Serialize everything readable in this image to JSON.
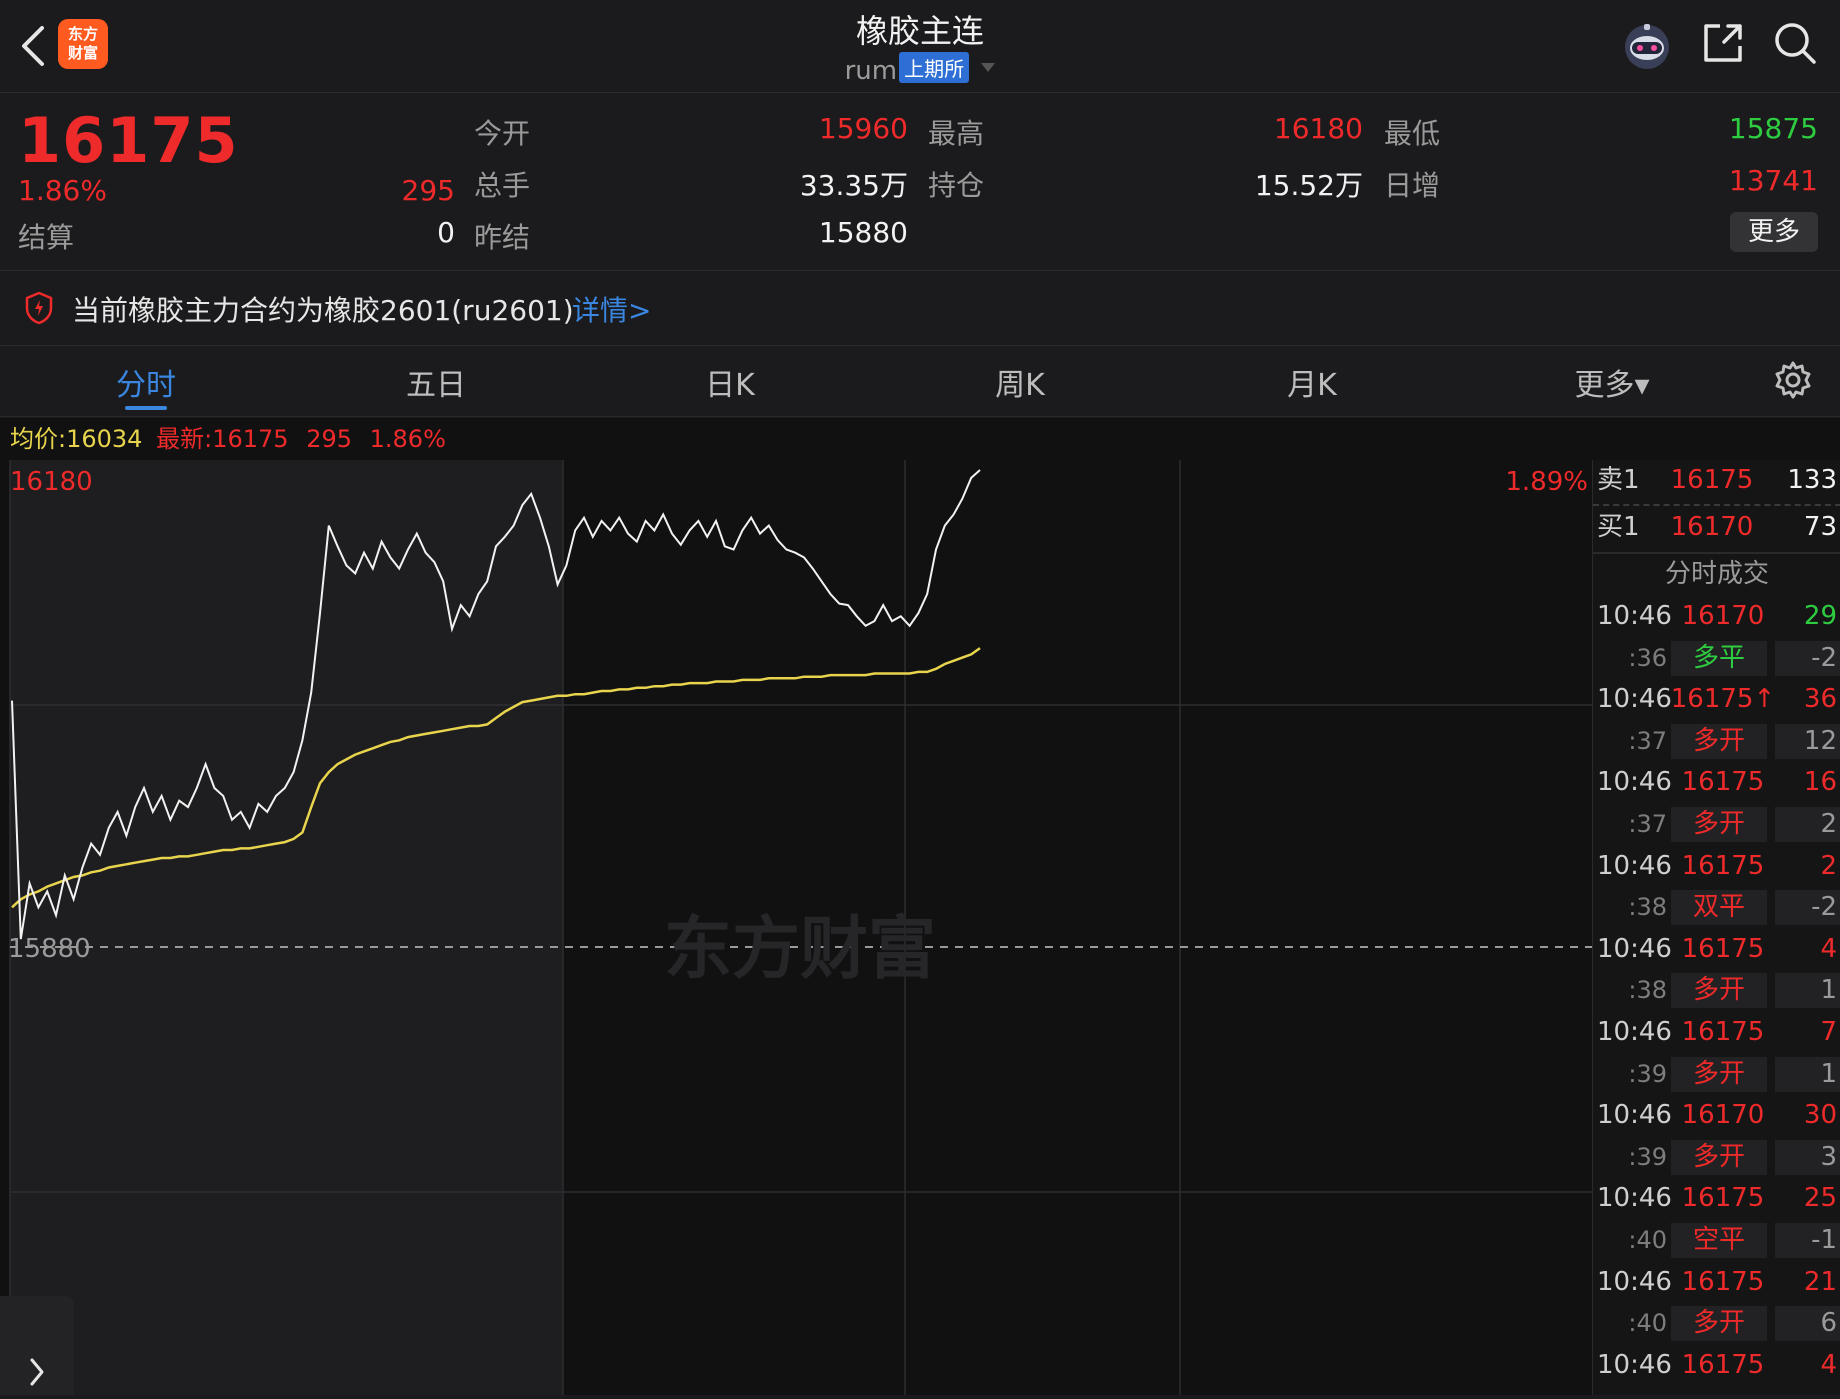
{
  "header": {
    "title": "橡胶主连",
    "code": "rum",
    "exchange": "上期所",
    "logo_line1": "东方",
    "logo_line2": "财富"
  },
  "quote": {
    "last_price": "16175",
    "change_pct": "1.86%",
    "change_value": "295",
    "settle_label": "结算",
    "settle_value": "0",
    "open_label": "今开",
    "open_value": "15960",
    "high_label": "最高",
    "high_value": "16180",
    "low_label": "最低",
    "low_value": "15875",
    "volume_label": "总手",
    "volume_value": "33.35万",
    "open_interest_label": "持仓",
    "open_interest_value": "15.52万",
    "daily_increase_label": "日增",
    "daily_increase_value": "13741",
    "prev_settle_label": "昨结",
    "prev_settle_value": "15880",
    "more_label": "更多"
  },
  "notice": {
    "text": "当前橡胶主力合约为橡胶2601(ru2601)",
    "link": "详情>"
  },
  "tabs": [
    {
      "label": "分时"
    },
    {
      "label": "五日"
    },
    {
      "label": "日K"
    },
    {
      "label": "周K"
    },
    {
      "label": "月K"
    },
    {
      "label": "更多▾"
    }
  ],
  "info_line": {
    "avg_label": "均价:",
    "avg_value": "16034",
    "latest_label": "最新:",
    "latest_price": "16175",
    "latest_change": "295",
    "latest_pct": "1.86%"
  },
  "chart_data": {
    "type": "line",
    "top_label": "16180",
    "top_pct_label": "1.89%",
    "ref_label": "15880",
    "watermark": "东方财富",
    "y_range": [
      15875,
      16180
    ],
    "ref_value": 15880,
    "series": [
      {
        "values": [
          16035,
          15885,
          15920,
          15905,
          15915,
          15900,
          15925,
          15910,
          15930,
          15945,
          15938,
          15955,
          15965,
          15950,
          15968,
          15980,
          15965,
          15975,
          15960,
          15972,
          15968,
          15980,
          15995,
          15980,
          15975,
          15960,
          15965,
          15955,
          15970,
          15965,
          15975,
          15980,
          15990,
          16010,
          16040,
          16090,
          16145,
          16132,
          16120,
          16115,
          16128,
          16118,
          16135,
          16125,
          16118,
          16130,
          16140,
          16128,
          16122,
          16110,
          16080,
          16095,
          16088,
          16102,
          16110,
          16132,
          16138,
          16145,
          16158,
          16165,
          16150,
          16132,
          16108,
          16120,
          16142,
          16150,
          16138,
          16148,
          16142,
          16150,
          16140,
          16135,
          16148,
          16142,
          16152,
          16140,
          16133,
          16142,
          16148,
          16138,
          16148,
          16132,
          16130,
          16142,
          16150,
          16140,
          16145,
          16136,
          16130,
          16128,
          16125,
          16118,
          16110,
          16102,
          16096,
          16095,
          16088,
          16082,
          16085,
          16095,
          16085,
          16088,
          16082,
          16090,
          16102,
          16130,
          16145,
          16152,
          16162,
          16175,
          16180
        ],
        "color": "#f2f2f2"
      },
      {
        "name": "均价",
        "values": [
          15905,
          15910,
          15913,
          15915,
          15918,
          15920,
          15922,
          15924,
          15925,
          15927,
          15928,
          15930,
          15931,
          15932,
          15933,
          15934,
          15935,
          15936,
          15936,
          15937,
          15937,
          15938,
          15939,
          15940,
          15941,
          15941,
          15942,
          15942,
          15943,
          15944,
          15945,
          15946,
          15948,
          15952,
          15968,
          15983,
          15990,
          15995,
          15998,
          16001,
          16003,
          16005,
          16007,
          16009,
          16010,
          16012,
          16013,
          16014,
          16015,
          16016,
          16017,
          16018,
          16019,
          16019,
          16020,
          16024,
          16028,
          16031,
          16034,
          16035,
          16036,
          16037,
          16038,
          16038,
          16039,
          16039,
          16040,
          16041,
          16041,
          16042,
          16042,
          16043,
          16043,
          16044,
          16044,
          16045,
          16045,
          16046,
          16046,
          16046,
          16047,
          16047,
          16047,
          16048,
          16048,
          16048,
          16049,
          16049,
          16049,
          16049,
          16050,
          16050,
          16050,
          16051,
          16051,
          16051,
          16051,
          16051,
          16052,
          16052,
          16052,
          16052,
          16052,
          16053,
          16053,
          16055,
          16058,
          16060,
          16062,
          16064,
          16068
        ],
        "color": "#e8d44d"
      }
    ]
  },
  "orderbook": {
    "ask_label": "卖1",
    "ask_price": "16175",
    "ask_volume": "133",
    "bid_label": "买1",
    "bid_price": "16170",
    "bid_volume": "73",
    "trades_title": "分时成交"
  },
  "trades": [
    {
      "time": "10:46",
      "price": "16170",
      "vol": "29",
      "vol_color": "#2ecc40",
      "sub_time": ":36",
      "sub_type": "多平",
      "sub_type_color": "#2ecc40",
      "sub_vol": "-2"
    },
    {
      "time": "10:46",
      "price": "16175↑",
      "vol": "36",
      "vol_color": "#ee2a2a",
      "sub_time": ":37",
      "sub_type": "多开",
      "sub_type_color": "#ee2a2a",
      "sub_vol": "12"
    },
    {
      "time": "10:46",
      "price": "16175",
      "vol": "16",
      "vol_color": "#ee2a2a",
      "sub_time": ":37",
      "sub_type": "多开",
      "sub_type_color": "#ee2a2a",
      "sub_vol": "2"
    },
    {
      "time": "10:46",
      "price": "16175",
      "vol": "2",
      "vol_color": "#ee2a2a",
      "sub_time": ":38",
      "sub_type": "双平",
      "sub_type_color": "#ee2a2a",
      "sub_vol": "-2"
    },
    {
      "time": "10:46",
      "price": "16175",
      "vol": "4",
      "vol_color": "#ee2a2a",
      "sub_time": ":38",
      "sub_type": "多开",
      "sub_type_color": "#ee2a2a",
      "sub_vol": "1"
    },
    {
      "time": "10:46",
      "price": "16175",
      "vol": "7",
      "vol_color": "#ee2a2a",
      "sub_time": ":39",
      "sub_type": "多开",
      "sub_type_color": "#ee2a2a",
      "sub_vol": "1"
    },
    {
      "time": "10:46",
      "price": "16170",
      "vol": "30",
      "vol_color": "#ee2a2a",
      "sub_time": ":39",
      "sub_type": "多开",
      "sub_type_color": "#ee2a2a",
      "sub_vol": "3"
    },
    {
      "time": "10:46",
      "price": "16175",
      "vol": "25",
      "vol_color": "#ee2a2a",
      "sub_time": ":40",
      "sub_type": "空平",
      "sub_type_color": "#ee2a2a",
      "sub_vol": "-1"
    },
    {
      "time": "10:46",
      "price": "16175",
      "vol": "21",
      "vol_color": "#ee2a2a",
      "sub_time": ":40",
      "sub_type": "多开",
      "sub_type_color": "#ee2a2a",
      "sub_vol": "6"
    },
    {
      "time": "10:46",
      "price": "16175",
      "vol": "4",
      "vol_color": "#ee2a2a"
    }
  ]
}
